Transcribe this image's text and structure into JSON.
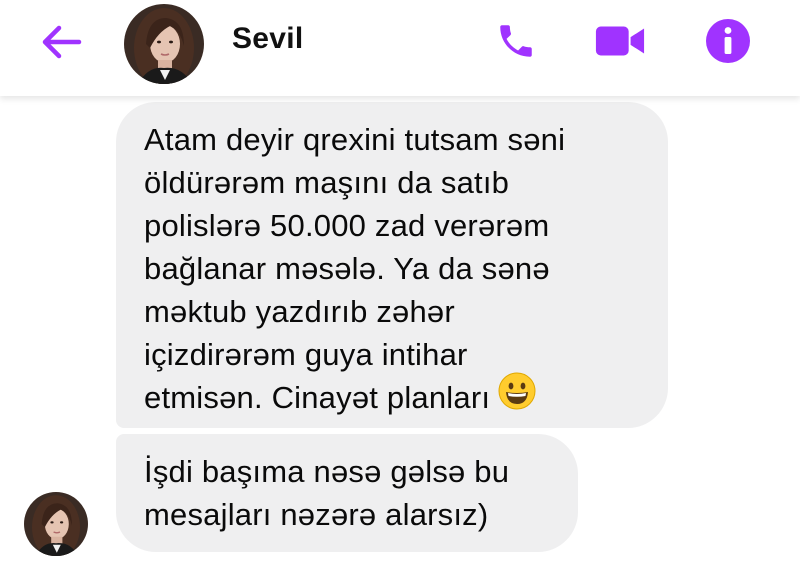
{
  "header": {
    "contact_name": "Sevil",
    "icons": {
      "back": "arrow-left-icon",
      "call": "phone-icon",
      "video": "video-camera-icon",
      "info": "info-icon"
    },
    "accent_color": "#a033ff"
  },
  "messages": [
    {
      "lines": [
        "Atam deyir qrexini tutsam səni",
        "öldürərəm maşını da satıb",
        "polislərə 50.000 zad verərəm",
        "bağlanar məsələ. Ya da sənə",
        "məktub yazdırıb zəhər",
        "içizdirərəm guya intihar",
        "etmisən. Cinayət planları"
      ],
      "emoji": "grinning-face-emoji"
    },
    {
      "lines": [
        "İşdi başıma nəsə gəlsə bu",
        "mesajları nəzərə alarsız)"
      ]
    }
  ],
  "bubble_color": "#efeff0"
}
